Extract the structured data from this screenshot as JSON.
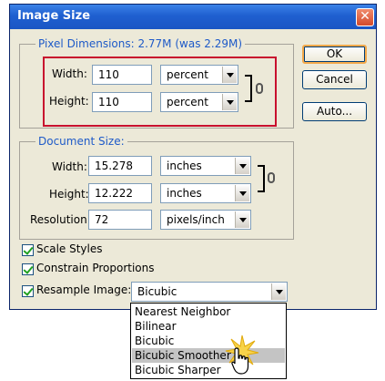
{
  "window": {
    "title": "Image Size",
    "close_glyph": "✕"
  },
  "pixel_dimensions": {
    "legend": "Pixel Dimensions:  2.77M (was 2.29M)",
    "width_label": "Width:",
    "width_value": "110",
    "width_unit": "percent",
    "height_label": "Height:",
    "height_value": "110",
    "height_unit": "percent"
  },
  "document_size": {
    "legend": "Document Size:",
    "width_label": "Width:",
    "width_value": "15.278",
    "width_unit": "inches",
    "height_label": "Height:",
    "height_value": "12.222",
    "height_unit": "inches",
    "resolution_label": "Resolution:",
    "resolution_value": "72",
    "resolution_unit": "pixels/inch"
  },
  "buttons": {
    "ok": "OK",
    "cancel": "Cancel",
    "auto": "Auto..."
  },
  "options": {
    "scale_styles": {
      "label": "Scale Styles",
      "checked": true
    },
    "constrain_proportions": {
      "label": "Constrain Proportions",
      "checked": true
    },
    "resample_image": {
      "label": "Resample Image:",
      "checked": true,
      "value": "Bicubic"
    }
  },
  "resample_menu": {
    "items": [
      "Nearest Neighbor",
      "Bilinear",
      "Bicubic",
      "Bicubic Smoother",
      "Bicubic Sharper"
    ],
    "highlighted": "Bicubic Smoother"
  },
  "icons": {
    "chain": "chain-link-icon",
    "cursor": "hand-pointer-icon",
    "click_burst": "click-burst-icon"
  },
  "colors": {
    "title_bar": "#1f5fd0",
    "legend_text": "#1e5ac8",
    "highlight_box": "#c8102e",
    "menu_highlight": "#c4c4c4"
  }
}
